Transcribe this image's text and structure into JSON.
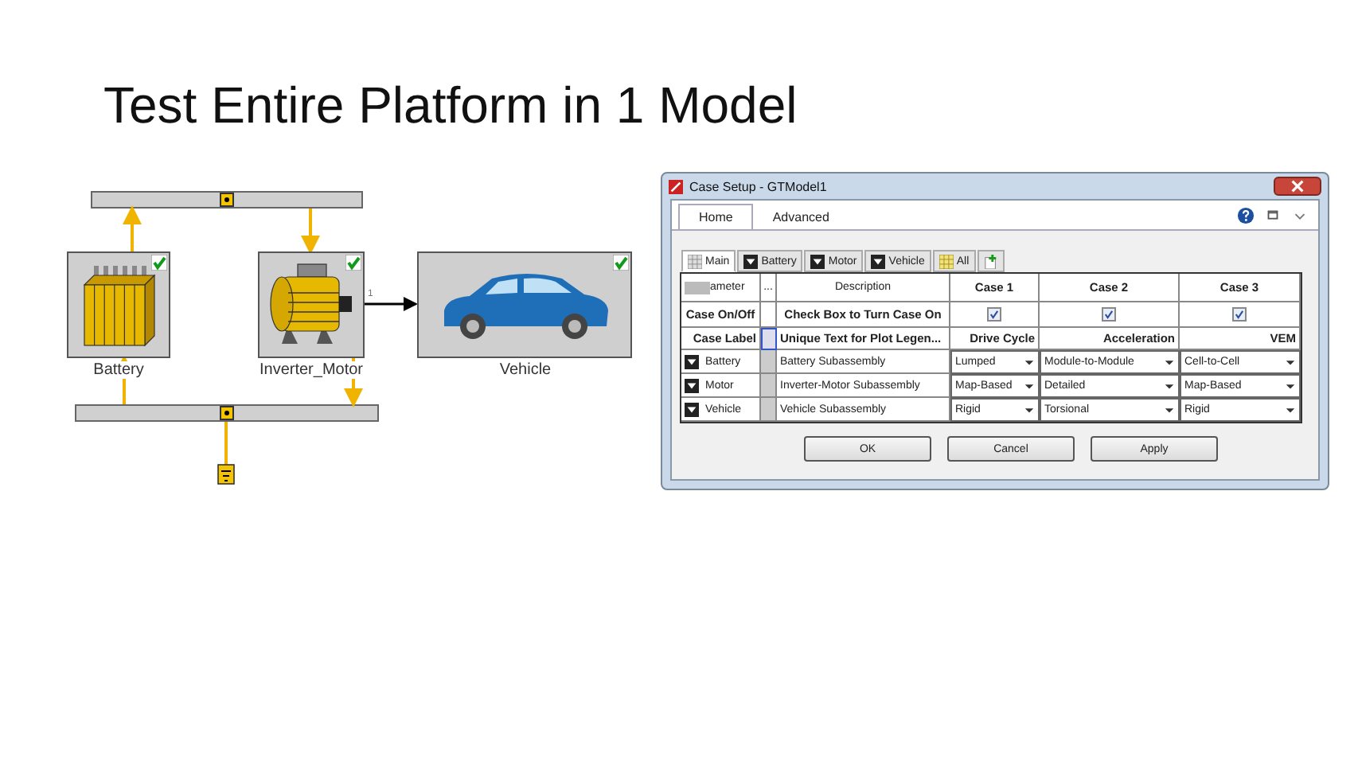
{
  "slide": {
    "title": "Test Entire Platform in 1 Model"
  },
  "diagram": {
    "components": [
      {
        "label": "Battery",
        "kind": "battery"
      },
      {
        "label": "Inverter_Motor",
        "kind": "motor"
      },
      {
        "label": "Vehicle",
        "kind": "vehicle"
      }
    ],
    "port_label": "1"
  },
  "dialog": {
    "title": "Case Setup - GTModel1",
    "ribbon_tabs": [
      {
        "label": "Home",
        "selected": true
      },
      {
        "label": "Advanced",
        "selected": false
      }
    ],
    "sheet_tabs": [
      {
        "label": "Main",
        "kind": "grid",
        "selected": true
      },
      {
        "label": "Battery",
        "kind": "folder",
        "selected": false
      },
      {
        "label": "Motor",
        "kind": "folder",
        "selected": false
      },
      {
        "label": "Vehicle",
        "kind": "folder",
        "selected": false
      },
      {
        "label": "All",
        "kind": "all",
        "selected": false
      }
    ],
    "table": {
      "header": {
        "parameter": "ameter",
        "more": "...",
        "description": "Description",
        "cases": [
          "Case 1",
          "Case 2",
          "Case 3"
        ]
      },
      "on_row": {
        "label": "Case On/Off",
        "description": "Check Box to Turn Case On",
        "cases": [
          {
            "checked": true
          },
          {
            "checked": true
          },
          {
            "checked": true
          }
        ]
      },
      "label_row": {
        "label": "Case Label",
        "description": "Unique Text for Plot Legen...",
        "values": [
          "Drive Cycle",
          "Acceleration",
          "VEM"
        ]
      },
      "rows": [
        {
          "name": "Battery",
          "description": "Battery Subassembly",
          "values": [
            "Lumped",
            "Module-to-Module",
            "Cell-to-Cell"
          ]
        },
        {
          "name": "Motor",
          "description": "Inverter-Motor Subassembly",
          "values": [
            "Map-Based",
            "Detailed",
            "Map-Based"
          ]
        },
        {
          "name": "Vehicle",
          "description": "Vehicle Subassembly",
          "values": [
            "Rigid",
            "Torsional",
            "Rigid"
          ]
        }
      ]
    },
    "buttons": [
      "OK",
      "Cancel",
      "Apply"
    ]
  }
}
